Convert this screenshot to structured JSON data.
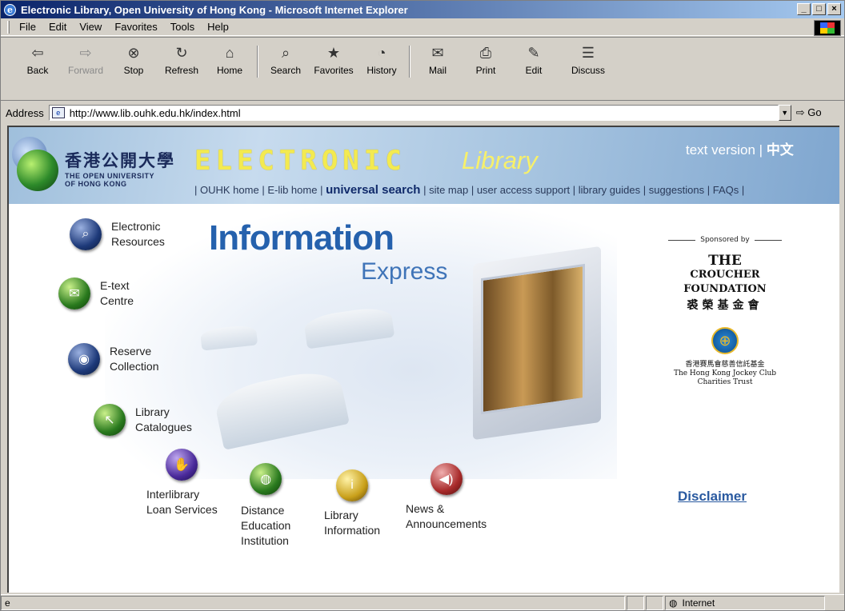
{
  "window": {
    "title": "Electronic Library, Open University of Hong Kong - Microsoft Internet Explorer",
    "controls": [
      "_",
      "□",
      "×"
    ]
  },
  "menu": [
    "File",
    "Edit",
    "View",
    "Favorites",
    "Tools",
    "Help"
  ],
  "toolbar": {
    "buttons": [
      {
        "label": "Back",
        "icon": "back-arrow-icon",
        "glyph": "⇦",
        "disabled": false
      },
      {
        "label": "Forward",
        "icon": "forward-arrow-icon",
        "glyph": "⇨",
        "disabled": true
      },
      {
        "label": "Stop",
        "icon": "stop-icon",
        "glyph": "⊗",
        "disabled": false
      },
      {
        "label": "Refresh",
        "icon": "refresh-icon",
        "glyph": "↻",
        "disabled": false
      },
      {
        "label": "Home",
        "icon": "home-icon",
        "glyph": "⌂",
        "disabled": false
      },
      {
        "label": "Search",
        "icon": "search-icon",
        "glyph": "⌕",
        "disabled": false
      },
      {
        "label": "Favorites",
        "icon": "favorites-icon",
        "glyph": "★",
        "disabled": false
      },
      {
        "label": "History",
        "icon": "history-icon",
        "glyph": "◔",
        "disabled": false
      },
      {
        "label": "Mail",
        "icon": "mail-icon",
        "glyph": "✉",
        "disabled": false
      },
      {
        "label": "Print",
        "icon": "print-icon",
        "glyph": "⎙",
        "disabled": false
      },
      {
        "label": "Edit",
        "icon": "edit-icon",
        "glyph": "✎",
        "disabled": false
      },
      {
        "label": "Discuss",
        "icon": "discuss-icon",
        "glyph": "☰",
        "disabled": false
      }
    ]
  },
  "address": {
    "label": "Address",
    "url": "http://www.lib.ouhk.edu.hk/index.html",
    "go": "Go"
  },
  "page": {
    "ouhk_zh": "香港公開大學",
    "ouhk_en_1": "THE OPEN UNIVERSITY",
    "ouhk_en_2": "OF HONG KONG",
    "elib": "ELECTRONIC",
    "library": "Library",
    "text_version": "text version",
    "chinese": "中文",
    "nav": [
      "OUHK home",
      "E-lib home",
      "universal search",
      "site map",
      "user access support",
      "library guides",
      "suggestions",
      "FAQs"
    ],
    "hero_title": "Information",
    "hero_sub": "Express",
    "resources": [
      {
        "line1": "Electronic",
        "line2": "Resources"
      },
      {
        "line1": "E-text",
        "line2": "Centre"
      },
      {
        "line1": "Reserve",
        "line2": "Collection"
      },
      {
        "line1": "Library",
        "line2": "Catalogues"
      }
    ],
    "services": [
      {
        "line1": "Interlibrary",
        "line2": "Loan Services",
        "line3": ""
      },
      {
        "line1": "Distance",
        "line2": "Education",
        "line3": "Institution"
      },
      {
        "line1": "Library",
        "line2": "Information",
        "line3": ""
      },
      {
        "line1": "News &",
        "line2": "Announcements",
        "line3": ""
      }
    ],
    "sponsored_by": "Sponsored by",
    "croucher_1": "THE",
    "croucher_2": "CROUCHER",
    "croucher_3": "FOUNDATION",
    "croucher_zh": "裘榮基金會",
    "jockey_zh": "香港賽馬會慈善信託基金",
    "jockey_en": "The Hong Kong Jockey Club Charities Trust",
    "disclaimer": "Disclaimer"
  },
  "status": {
    "zone": "Internet"
  }
}
